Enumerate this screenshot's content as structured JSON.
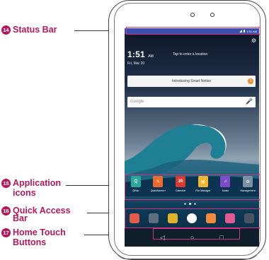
{
  "callouts": {
    "status": {
      "num": "14",
      "label": "Status Bar"
    },
    "apps": {
      "num": "15",
      "line1": "Application",
      "line2": "icons"
    },
    "qa": {
      "num": "16",
      "line1": "Quick Access",
      "line2": "Bar"
    },
    "home": {
      "num": "17",
      "line1": "Home Touch",
      "line2": "Buttons"
    }
  },
  "screen": {
    "status_time": "1:51 AM",
    "clock": "1:51",
    "ampm": "AM",
    "date": "Fri, Mar 20",
    "weather_hint": "Tap to enter a location",
    "notice": "Introducing Smart Notice",
    "notice_count": "3",
    "search_placeholder": "Google",
    "apps": [
      {
        "label": "QPair",
        "color": "#2aa69a",
        "glyph": "Q"
      },
      {
        "label": "QuickMemo+",
        "color": "#e96b2d",
        "glyph": "✎"
      },
      {
        "label": "Calendar",
        "color": "#d83a32",
        "glyph": "20"
      },
      {
        "label": "File Manager",
        "color": "#f2b530",
        "glyph": "▤"
      },
      {
        "label": "Music",
        "color": "#7d4cc8",
        "glyph": "♫"
      },
      {
        "label": "Management",
        "color": "#7e90a6",
        "glyph": "⚙"
      }
    ],
    "quick_access": [
      {
        "name": "phone-apps-icon",
        "color": "#e25b4a"
      },
      {
        "name": "play-store-icon",
        "color": "#5f6e7f"
      },
      {
        "name": "chrome-icon",
        "color": "#e0b32a"
      },
      {
        "name": "apps-drawer-icon",
        "color": "#ffffff"
      },
      {
        "name": "messaging-icon",
        "color": "#f08a3c"
      },
      {
        "name": "gallery-icon",
        "color": "#e35a93"
      },
      {
        "name": "camera-icon",
        "color": "#4a5563"
      }
    ],
    "nav": {
      "back": "◁",
      "home": "○",
      "recent": "□"
    }
  }
}
